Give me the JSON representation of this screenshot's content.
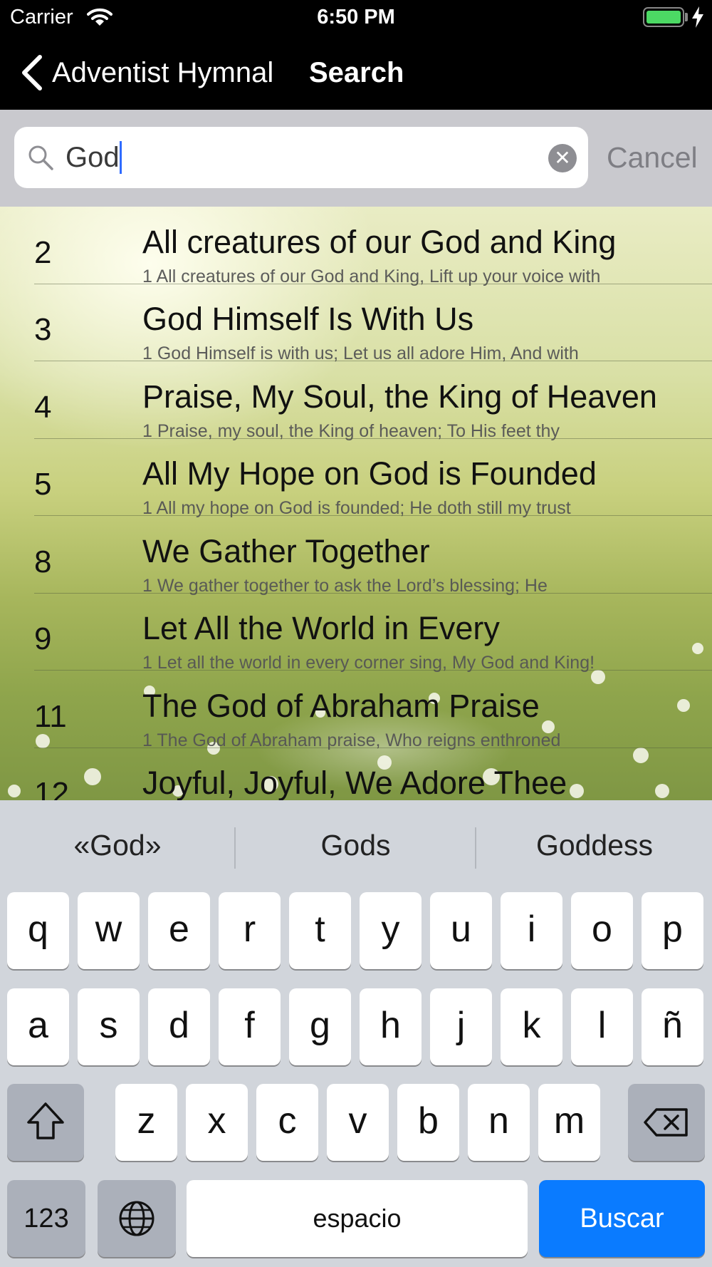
{
  "status_bar": {
    "carrier": "Carrier",
    "time": "6:50 PM"
  },
  "nav": {
    "back_label": "Adventist Hymnal",
    "title": "Search"
  },
  "search": {
    "value": "God",
    "cancel_label": "Cancel"
  },
  "results": [
    {
      "number": "2",
      "title": "All creatures of our God and King",
      "lyric": "1 All creatures of our God and King, Lift up your voice with"
    },
    {
      "number": "3",
      "title": "God Himself Is With Us",
      "lyric": "1 God Himself is with us; Let us all adore Him, And with"
    },
    {
      "number": "4",
      "title": "Praise, My Soul, the King of Heaven",
      "lyric": "1 Praise, my soul, the King of heaven; To His feet thy"
    },
    {
      "number": "5",
      "title": "All My Hope on God is Founded",
      "lyric": "1 All my hope on God is founded; He doth still my trust"
    },
    {
      "number": "8",
      "title": "We Gather Together",
      "lyric": "1 We gather together to ask the Lord’s blessing; He"
    },
    {
      "number": "9",
      "title": "Let All the World in Every",
      "lyric": "1 Let all the world in every corner sing, My God and King!"
    },
    {
      "number": "11",
      "title": "The God of Abraham Praise",
      "lyric": "1 The God of Abraham praise, Who reigns enthroned"
    },
    {
      "number": "12",
      "title": "Joyful, Joyful, We Adore Thee",
      "lyric": ""
    }
  ],
  "keyboard": {
    "suggestions": [
      "«God»",
      "Gods",
      "Goddess"
    ],
    "row1": [
      "q",
      "w",
      "e",
      "r",
      "t",
      "y",
      "u",
      "i",
      "o",
      "p"
    ],
    "row2": [
      "a",
      "s",
      "d",
      "f",
      "g",
      "h",
      "j",
      "k",
      "l",
      "ñ"
    ],
    "row3": [
      "z",
      "x",
      "c",
      "v",
      "b",
      "n",
      "m"
    ],
    "numbers_label": "123",
    "space_label": "espacio",
    "return_label": "Buscar",
    "accent_color": "#0a7bff"
  }
}
